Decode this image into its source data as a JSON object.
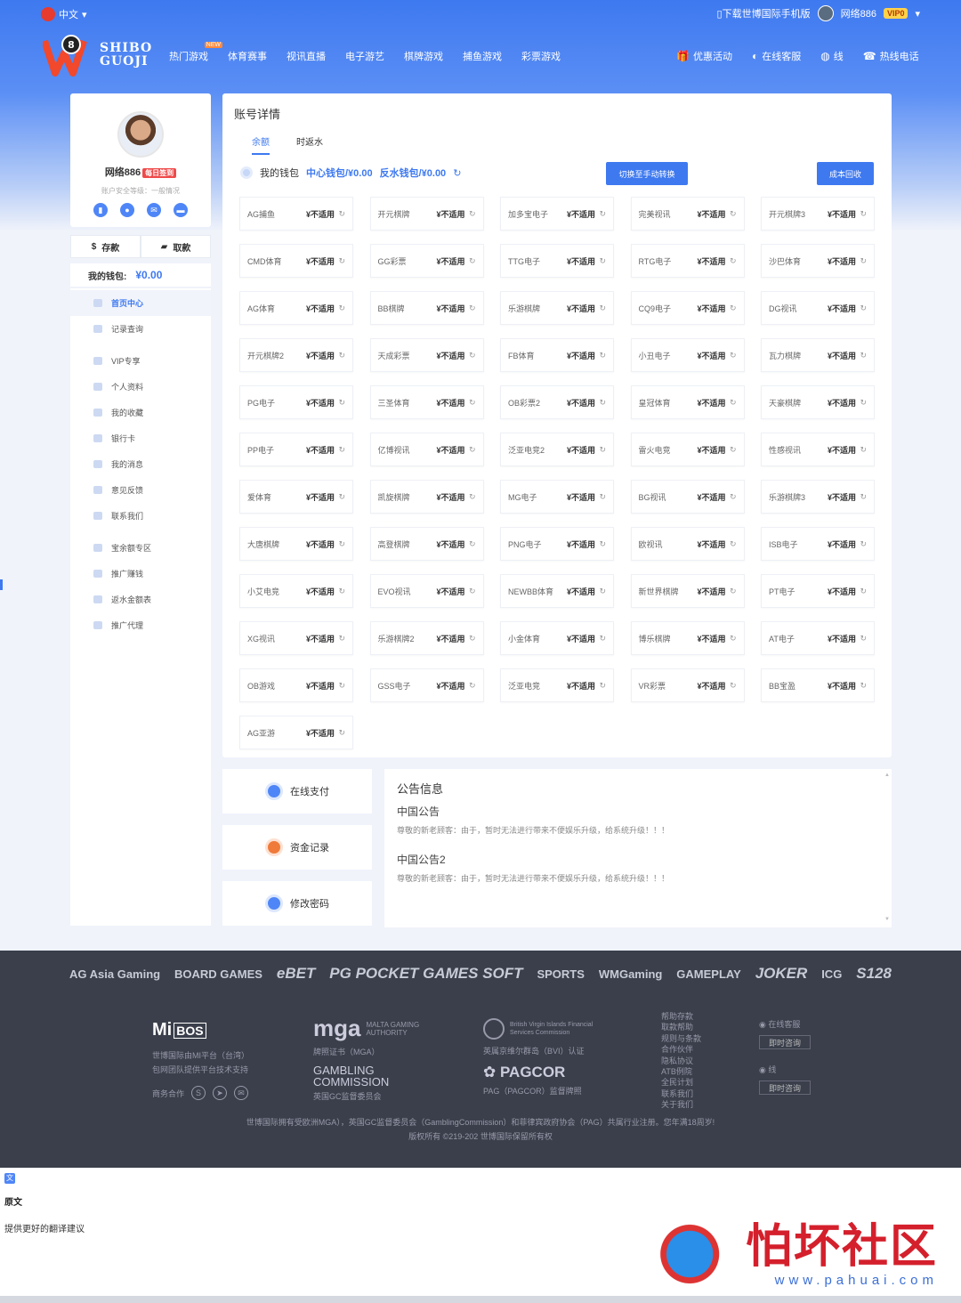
{
  "topbar": {
    "lang": "中文",
    "download": "下载世博国际手机版",
    "username": "网络886",
    "vip": "VIP0"
  },
  "logo": {
    "line1": "SHIBO",
    "line2": "GUOJI"
  },
  "nav": [
    {
      "label": "热门游戏",
      "badge": "NEW"
    },
    {
      "label": "体育赛事"
    },
    {
      "label": "视讯直播"
    },
    {
      "label": "电子游艺"
    },
    {
      "label": "棋牌游戏"
    },
    {
      "label": "捕鱼游戏"
    },
    {
      "label": "彩票游戏"
    }
  ],
  "nav_right": [
    {
      "label": "优惠活动",
      "icon": "gift-icon"
    },
    {
      "label": "在线客服",
      "icon": "headset-icon"
    },
    {
      "label": "线",
      "icon": "line-icon"
    },
    {
      "label": "热线电话",
      "icon": "phone-icon"
    }
  ],
  "profile": {
    "name": "网络886",
    "sign": "每日签到",
    "security": "账户安全等级：一般情况",
    "deposit": "存款",
    "withdraw": "取款",
    "wallet_label": "我的钱包:",
    "wallet_value": "¥0.00"
  },
  "menu": [
    {
      "label": "首页中心",
      "active": true
    },
    {
      "label": "记录查询"
    },
    {
      "gap": true
    },
    {
      "label": "VIP专享"
    },
    {
      "label": "个人资料"
    },
    {
      "label": "我的收藏"
    },
    {
      "label": "银行卡"
    },
    {
      "label": "我的消息"
    },
    {
      "label": "意见反馈"
    },
    {
      "label": "联系我们"
    },
    {
      "gap": true
    },
    {
      "label": "宝余额专区"
    },
    {
      "label": "推广赚钱"
    },
    {
      "label": "返水金额表"
    },
    {
      "label": "推广代理"
    }
  ],
  "main": {
    "title": "账号详情",
    "tabs": [
      "余额",
      "时返水"
    ],
    "wallet_label": "我的钱包",
    "center_wallet": "中心钱包/¥0.00",
    "rebate_wallet": "反水钱包/¥0.00",
    "switch_btn": "切换至手动转换",
    "recover_btn": "成本回收",
    "status": "¥不适用"
  },
  "games": [
    "AG捕鱼",
    "开元棋牌",
    "加多宝电子",
    "完美视讯",
    "开元棋牌3",
    "CMD体育",
    "GG彩票",
    "TTG电子",
    "RTG电子",
    "沙巴体育",
    "AG体育",
    "BB棋牌",
    "乐游棋牌",
    "CQ9电子",
    "DG视讯",
    "开元棋牌2",
    "天成彩票",
    "FB体育",
    "小丑电子",
    "瓦力棋牌",
    "PG电子",
    "三圣体育",
    "OB彩票2",
    "皇冠体育",
    "天豪棋牌",
    "PP电子",
    "亿博视讯",
    "泛亚电竞2",
    "雷火电竞",
    "性感视讯",
    "爱体育",
    "凯旋棋牌",
    "MG电子",
    "BG视讯",
    "乐游棋牌3",
    "大唐棋牌",
    "高登棋牌",
    "PNG电子",
    "欧视讯",
    "ISB电子",
    "小艾电竞",
    "EVO视讯",
    "NEWBB体育",
    "新世界棋牌",
    "PT电子",
    "XG视讯",
    "乐游棋牌2",
    "小金体育",
    "博乐棋牌",
    "AT电子",
    "OB游戏",
    "GSS电子",
    "泛亚电竞",
    "VR彩票",
    "BB宝盈",
    "AG亚游"
  ],
  "quick": [
    {
      "label": "在线支付",
      "icon": "wallet-icon"
    },
    {
      "label": "资金记录",
      "icon": "record-icon"
    },
    {
      "label": "修改密码",
      "icon": "lock-icon"
    }
  ],
  "notice": {
    "title": "公告信息",
    "items": [
      {
        "title": "中国公告",
        "text": "尊敬的新老顾客：由于，暂时无法进行带来不便娱乐升级，给系统升级！！！"
      },
      {
        "title": "中国公告2",
        "text": "尊敬的新老顾客：由于，暂时无法进行带来不便娱乐升级，给系统升级！！！"
      }
    ]
  },
  "footer": {
    "brands": [
      "AG Asia Gaming",
      "BOARD GAMES",
      "eBET",
      "PG POCKET GAMES SOFT",
      "SPORTS",
      "WMGaming",
      "GAMEPLAY",
      "JOKER",
      "ICG",
      "S128"
    ],
    "mibos": "Mi",
    "mibos_box": "BOS",
    "mibos_l1": "世博国际由MI平台（台湾）",
    "mibos_l2": "包网团队提供平台技术支持",
    "biz": "商务合作",
    "mga": "mga",
    "mga_sub": "MALTA GAMING AUTHORITY",
    "mga_cert": "牌照证书（MGA）",
    "gc1": "GAMBLING",
    "gc2": "COMMISSION",
    "gc_cert": "英国GC监督委员会",
    "bvi": "British Virgin Islands Financial Services Commission",
    "bvi_cert": "英属京维尔群岛（BVI）认证",
    "pagcor": "PAGCOR",
    "pagcor_cert": "PAG（PAGCOR）监督牌照",
    "links": [
      "帮助存款",
      "取款帮助",
      "规则与条款",
      "合作伙伴",
      "隐私协议",
      "ATB例院",
      "全民计划",
      "联系我们",
      "关于我们"
    ],
    "cs1": "在线客服",
    "cs_btn": "即时咨询",
    "cs2": "线",
    "legal": "世博国际拥有受欧洲MGA），英国GC监督委员会（GamblingCommission）和菲律宾政府协会（PAG）共属行业注册。您年满18周岁!",
    "copyright": "版权所有 ©219-202 世博国际保留所有权"
  },
  "translate": {
    "orig": "原文",
    "suggest": "提供更好的翻译建议"
  },
  "watermark": {
    "title": "怕坏社区",
    "url": "www.pahuai.com"
  }
}
